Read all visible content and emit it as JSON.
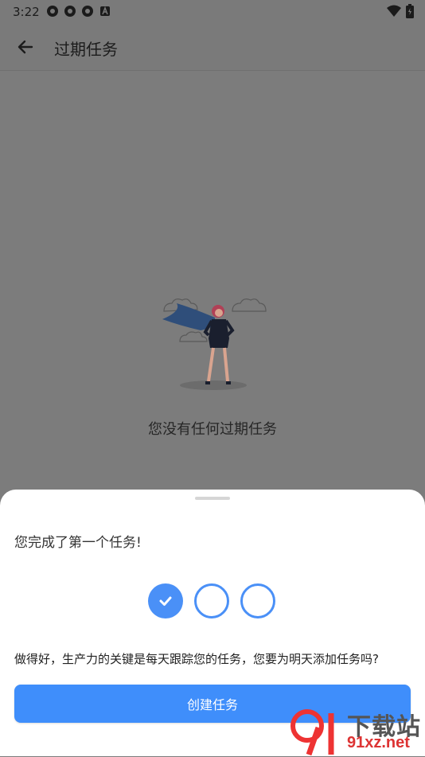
{
  "status_bar": {
    "time": "3:22",
    "icons": [
      "notification-icon",
      "notification-icon",
      "notification-icon",
      "a-badge-icon"
    ],
    "right_icons": [
      "wifi-icon",
      "battery-icon"
    ]
  },
  "app_bar": {
    "title": "过期任务",
    "back_icon": "arrow-left-icon"
  },
  "empty_state": {
    "message": "您没有任何过期任务",
    "illustration": "woman-with-cape-illustration"
  },
  "bottom_sheet": {
    "title": "您完成了第一个任务!",
    "progress": {
      "completed": 1,
      "total": 3
    },
    "message": "做得好，生产力的关键是每天跟踪您的任务，您要为明天添加任务吗?",
    "button_label": "创建任务"
  },
  "watermark": {
    "logo_text": "下载站",
    "url_text": "91xz.net"
  },
  "colors": {
    "accent": "#4a90f7",
    "button": "#3f8efb",
    "overlay": "#7c7c7c"
  }
}
